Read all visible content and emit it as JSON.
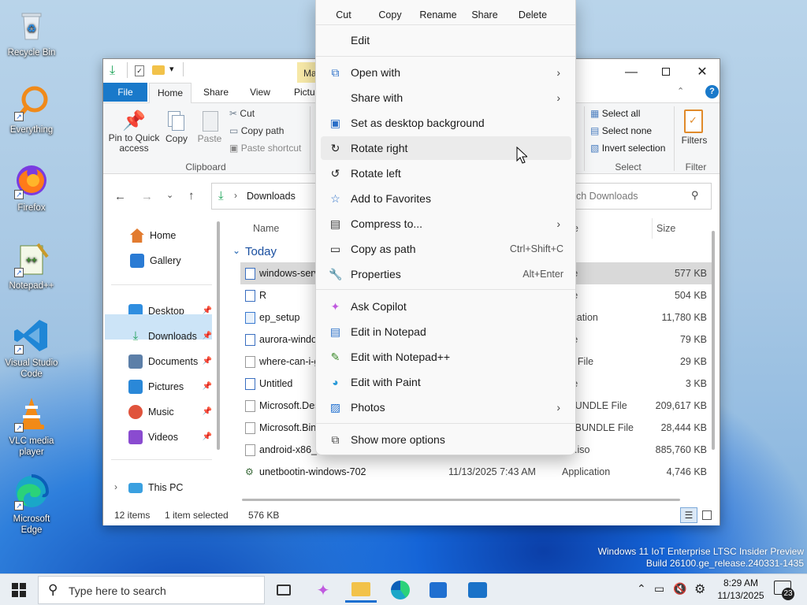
{
  "desktop": {
    "icons": [
      {
        "label": "Recycle Bin",
        "icon": "recycle-bin-icon"
      },
      {
        "label": "Everything",
        "icon": "everything-search-icon"
      },
      {
        "label": "Firefox",
        "icon": "firefox-icon"
      },
      {
        "label": "Notepad++",
        "icon": "notepad-plus-plus-icon"
      },
      {
        "label": "Visual Studio Code",
        "icon": "vscode-icon"
      },
      {
        "label": "VLC media player",
        "icon": "vlc-icon"
      },
      {
        "label": "Microsoft Edge",
        "icon": "edge-icon"
      }
    ],
    "watermark_line1": "Windows 11 IoT Enterprise LTSC Insider Preview",
    "watermark_line2": "Build 26100.ge_release.240331-1435"
  },
  "explorer": {
    "ribbon_tabs": [
      "File",
      "Home",
      "Share",
      "View",
      "Picture Tools"
    ],
    "manage_tab": "Manage",
    "clipboard": {
      "pin_label": "Pin to Quick access",
      "copy_label": "Copy",
      "paste_label": "Paste",
      "cut_label": "Cut",
      "copy_path_label": "Copy path",
      "paste_shortcut_label": "Paste shortcut",
      "group_label": "Clipboard"
    },
    "select": {
      "select_all": "Select all",
      "select_none": "Select none",
      "invert": "Invert selection",
      "group_label": "Select"
    },
    "filter": {
      "label": "Filters",
      "group_label": "Filter"
    },
    "address": {
      "crumb": "Downloads"
    },
    "search": {
      "placeholder": "ch Downloads"
    },
    "nav": {
      "quick": [
        {
          "label": "Home",
          "pinned": false,
          "color": "#e27b2f"
        },
        {
          "label": "Gallery",
          "pinned": false,
          "color": "#2a7bd4"
        }
      ],
      "pinned": [
        {
          "label": "Desktop",
          "color": "#2f8ee0"
        },
        {
          "label": "Downloads",
          "color": "#20a05a"
        },
        {
          "label": "Documents",
          "color": "#5c7fa8"
        },
        {
          "label": "Pictures",
          "color": "#2a88d8"
        },
        {
          "label": "Music",
          "color": "#e0533c"
        },
        {
          "label": "Videos",
          "color": "#8a4bd0"
        }
      ],
      "this_pc": "This PC"
    },
    "columns": {
      "name": "Name",
      "type": "e",
      "size": "Size"
    },
    "group_header": "Today",
    "files": [
      {
        "name": "windows-serv",
        "date": "",
        "type": "File",
        "size": "577 KB"
      },
      {
        "name": "R",
        "date": "",
        "type": "File",
        "size": "504 KB"
      },
      {
        "name": "ep_setup",
        "date": "",
        "type": "plication",
        "size": "11,780 KB"
      },
      {
        "name": "aurora-windo",
        "date": "",
        "type": "File",
        "size": "79 KB"
      },
      {
        "name": "where-can-i-g",
        "date": "",
        "type": "BP File",
        "size": "29 KB"
      },
      {
        "name": "Untitled",
        "date": "",
        "type": "File",
        "size": "3 KB"
      },
      {
        "name": "Microsoft.Des",
        "date": "",
        "type": "XBUNDLE File",
        "size": "209,617 KB"
      },
      {
        "name": "Microsoft.Bing",
        "date": "",
        "type": "PXBUNDLE File",
        "size": "28,444 KB"
      },
      {
        "name": "android-x86_6",
        "date": "",
        "type": "zip.iso",
        "size": "885,760 KB"
      },
      {
        "name": "unetbootin-windows-702",
        "date": "11/13/2025 7:43 AM",
        "type": "Application",
        "size": "4,746 KB"
      }
    ],
    "status": {
      "count": "12 items",
      "selected": "1 item selected",
      "size": "576 KB"
    }
  },
  "context_menu": {
    "quick_actions": [
      "Cut",
      "Copy",
      "Rename",
      "Share",
      "Delete"
    ],
    "edit": "Edit",
    "items": [
      {
        "label": "Open with",
        "accel": "",
        "submenu": true,
        "icon": "open-with-icon",
        "glyph": "⬚"
      },
      {
        "label": "Share with",
        "accel": "",
        "submenu": true,
        "icon": "share-with-icon",
        "glyph": ""
      },
      {
        "label": "Set as desktop background",
        "accel": "",
        "submenu": false,
        "icon": "wallpaper-icon",
        "glyph": "▣"
      },
      {
        "label": "Rotate right",
        "accel": "",
        "submenu": false,
        "icon": "rotate-right-icon",
        "glyph": "↻"
      },
      {
        "label": "Rotate left",
        "accel": "",
        "submenu": false,
        "icon": "rotate-left-icon",
        "glyph": "↺"
      },
      {
        "label": "Add to Favorites",
        "accel": "",
        "submenu": false,
        "icon": "star-icon",
        "glyph": "☆"
      },
      {
        "label": "Compress to...",
        "accel": "",
        "submenu": true,
        "icon": "compress-icon",
        "glyph": "▤"
      },
      {
        "label": "Copy as path",
        "accel": "Ctrl+Shift+C",
        "submenu": false,
        "icon": "copy-path-icon",
        "glyph": "▭"
      },
      {
        "label": "Properties",
        "accel": "Alt+Enter",
        "submenu": false,
        "icon": "wrench-icon",
        "glyph": "🔧"
      },
      {
        "label": "Ask Copilot",
        "accel": "",
        "submenu": false,
        "icon": "copilot-icon",
        "glyph": "✦"
      },
      {
        "label": "Edit in Notepad",
        "accel": "",
        "submenu": false,
        "icon": "notepad-icon",
        "glyph": "▤"
      },
      {
        "label": "Edit with Notepad++",
        "accel": "",
        "submenu": false,
        "icon": "notepad-plus-plus-icon",
        "glyph": "✎"
      },
      {
        "label": "Edit with Paint",
        "accel": "",
        "submenu": false,
        "icon": "paint-icon",
        "glyph": "◕"
      },
      {
        "label": "Photos",
        "accel": "",
        "submenu": true,
        "icon": "photos-icon",
        "glyph": "▨"
      },
      {
        "label": "Show more options",
        "accel": "",
        "submenu": false,
        "icon": "more-options-icon",
        "glyph": "⧉"
      }
    ]
  },
  "taskbar": {
    "search_placeholder": "Type here to search",
    "time": "8:29 AM",
    "date": "11/13/2025",
    "notifications": "23"
  }
}
